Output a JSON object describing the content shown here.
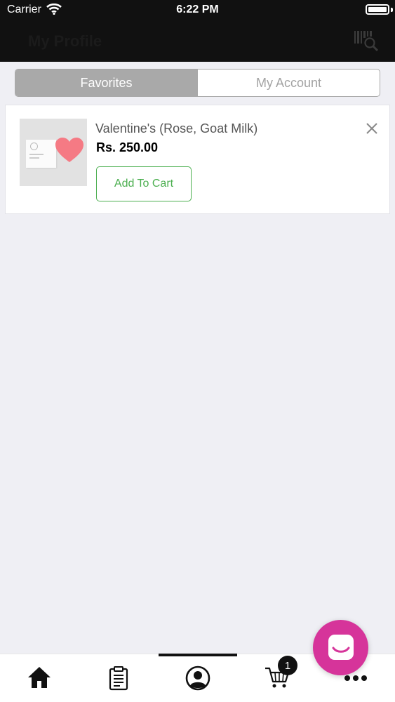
{
  "status_bar": {
    "carrier": "Carrier",
    "time": "6:22 PM"
  },
  "header": {
    "title": "My Profile",
    "right_icon": "barcode-search-icon"
  },
  "segments": [
    {
      "label": "Favorites",
      "active": true
    },
    {
      "label": "My Account",
      "active": false
    }
  ],
  "favorites": [
    {
      "name": "Valentine's (Rose, Goat Milk)",
      "price": "Rs. 250.00",
      "add_to_cart_label": "Add To Cart"
    }
  ],
  "tab_bar": {
    "items": [
      {
        "icon": "home-icon"
      },
      {
        "icon": "orders-icon"
      },
      {
        "icon": "profile-icon",
        "active": true
      },
      {
        "icon": "cart-icon",
        "badge": "1"
      },
      {
        "icon": "more-icon"
      }
    ]
  },
  "colors": {
    "accent_green": "#4caf50",
    "segment_active": "#a9a9a9",
    "chat_fab": "#d6349a",
    "header_bg": "#111111"
  }
}
